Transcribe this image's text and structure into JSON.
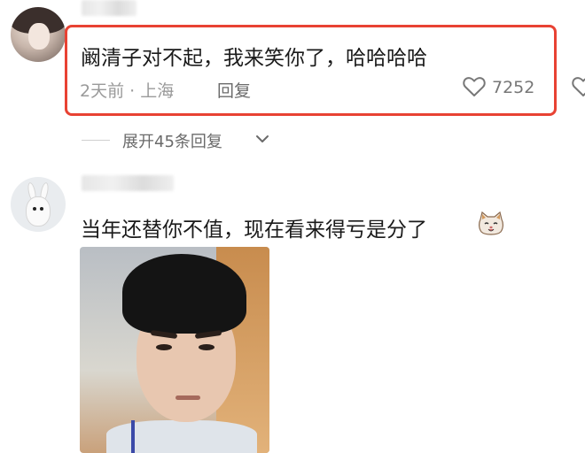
{
  "comments": [
    {
      "text": "阚清子对不起，我来笑你了，哈哈哈哈",
      "time_location": "2天前 · 上海",
      "reply_label": "回复",
      "like_count": "7252",
      "expand_replies": "展开45条回复"
    },
    {
      "text": "当年还替你不值，现在看来得亏是分了"
    }
  ],
  "colors": {
    "highlight": "#e84233",
    "meta_text": "#9a9a9a"
  },
  "icons": {
    "like": "heart-outline-icon",
    "expand": "chevron-down-icon",
    "emoji": "cat-face-emoji-icon"
  }
}
